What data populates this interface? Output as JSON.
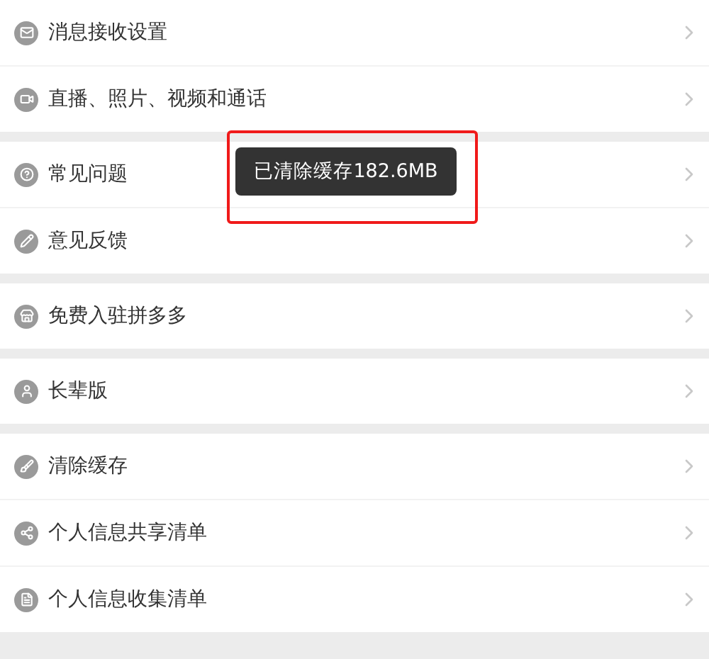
{
  "groups": [
    {
      "items": [
        {
          "label": "消息接收设置"
        },
        {
          "label": "直播、照片、视频和通话"
        }
      ]
    },
    {
      "items": [
        {
          "label": "常见问题"
        },
        {
          "label": "意见反馈"
        }
      ]
    },
    {
      "items": [
        {
          "label": "免费入驻拼多多"
        }
      ]
    },
    {
      "items": [
        {
          "label": "长辈版"
        }
      ]
    },
    {
      "items": [
        {
          "label": "清除缓存"
        },
        {
          "label": "个人信息共享清单"
        },
        {
          "label": "个人信息收集清单"
        }
      ]
    }
  ],
  "toast": {
    "text": "已清除缓存182.6MB"
  }
}
